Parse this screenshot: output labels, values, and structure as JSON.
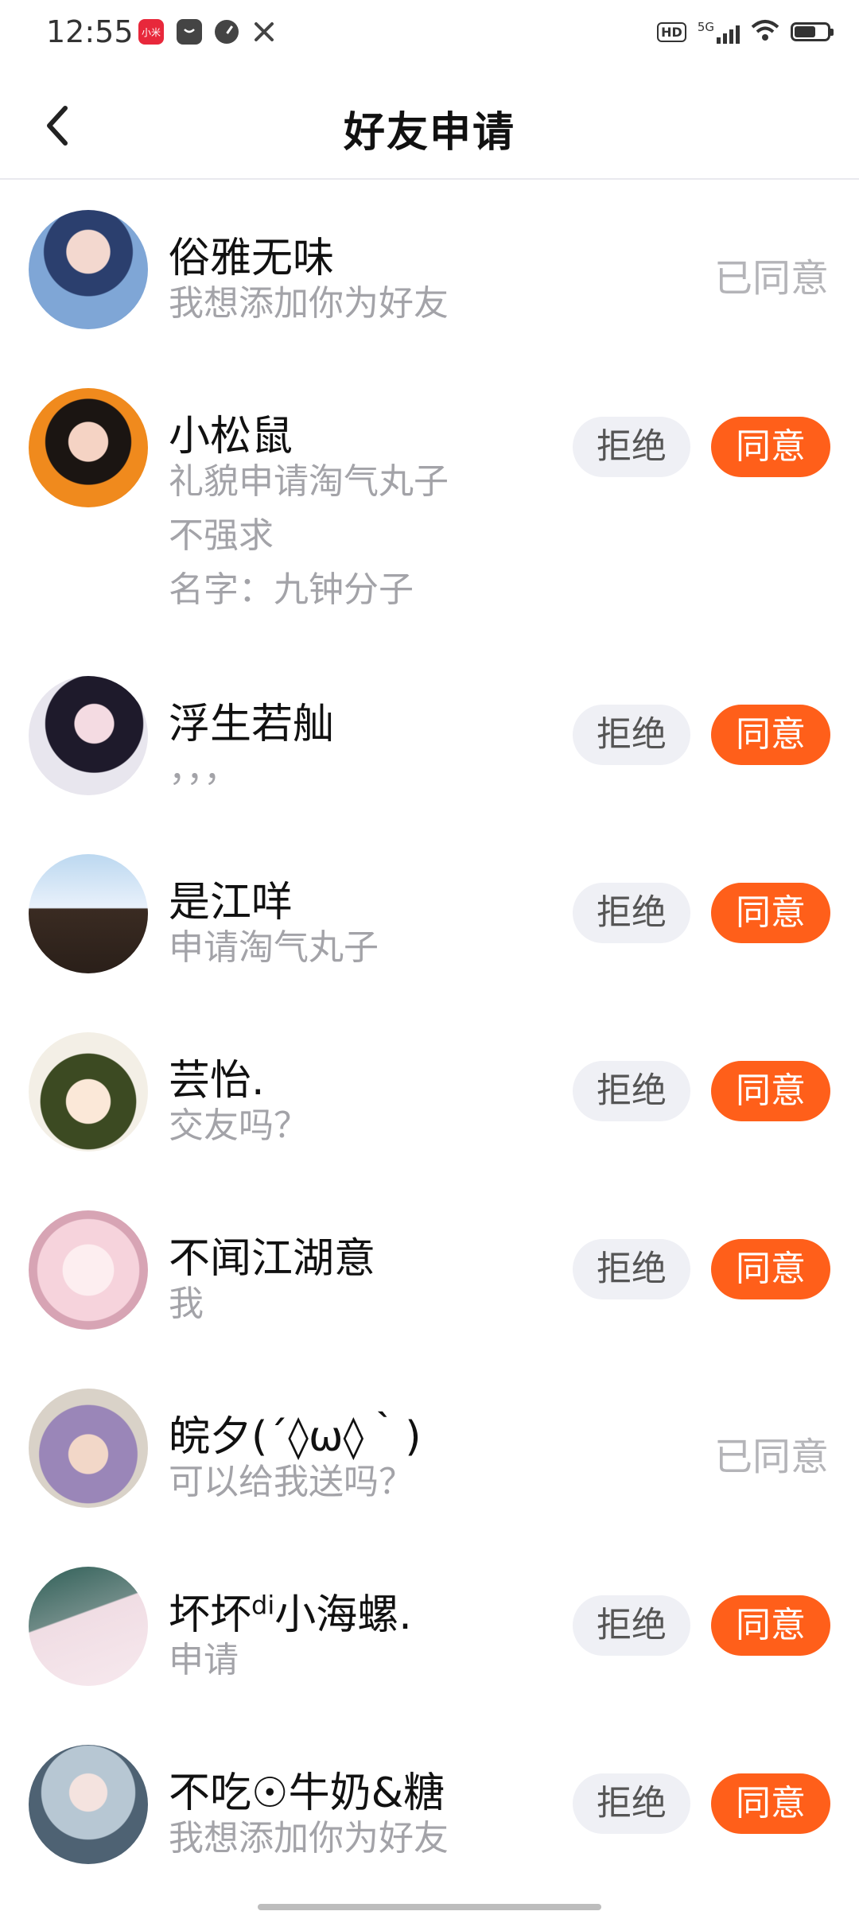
{
  "status_bar": {
    "time": "12:55",
    "left_apps": [
      "mi-app-icon",
      "shop-bag-icon",
      "speed-gauge-icon",
      "tools-icon"
    ],
    "mi_label": "小米",
    "hd_label": "HD",
    "network_label": "5G"
  },
  "header": {
    "title": "好友申请",
    "back_icon": "chevron-left-icon"
  },
  "colors": {
    "accept_bg": "#ff5f1a",
    "reject_bg": "#eff0f5",
    "muted_text": "#a3a3a8",
    "agreed_text": "#b4b4b8"
  },
  "labels": {
    "reject": "拒绝",
    "accept": "同意",
    "agreed": "已同意"
  },
  "requests": [
    {
      "name": "俗雅无味",
      "message": "我想添加你为好友",
      "status": "已同意"
    },
    {
      "name": "小松鼠",
      "message": "礼貌申请淘气丸子\n不强求\n名字：九钟分子",
      "status": "pending"
    },
    {
      "name": "浮生若舢",
      "message": "，，，",
      "status": "pending"
    },
    {
      "name": "是江咩",
      "message": "申请淘气丸子",
      "status": "pending"
    },
    {
      "name": "芸怡.",
      "message": "交友吗？",
      "status": "pending"
    },
    {
      "name": "不闻江湖意",
      "message": "我",
      "status": "pending"
    },
    {
      "name": "皖夕(´◊ω◊｀)",
      "message": "可以给我送吗？",
      "status": "已同意"
    },
    {
      "name_prefix": "坏坏",
      "name_sup": "di",
      "name_suffix": "小海螺.",
      "message": "申请",
      "status": "pending"
    },
    {
      "name": "不吃☉牛奶&糖",
      "message": "我想添加你为好友",
      "status": "pending"
    }
  ]
}
